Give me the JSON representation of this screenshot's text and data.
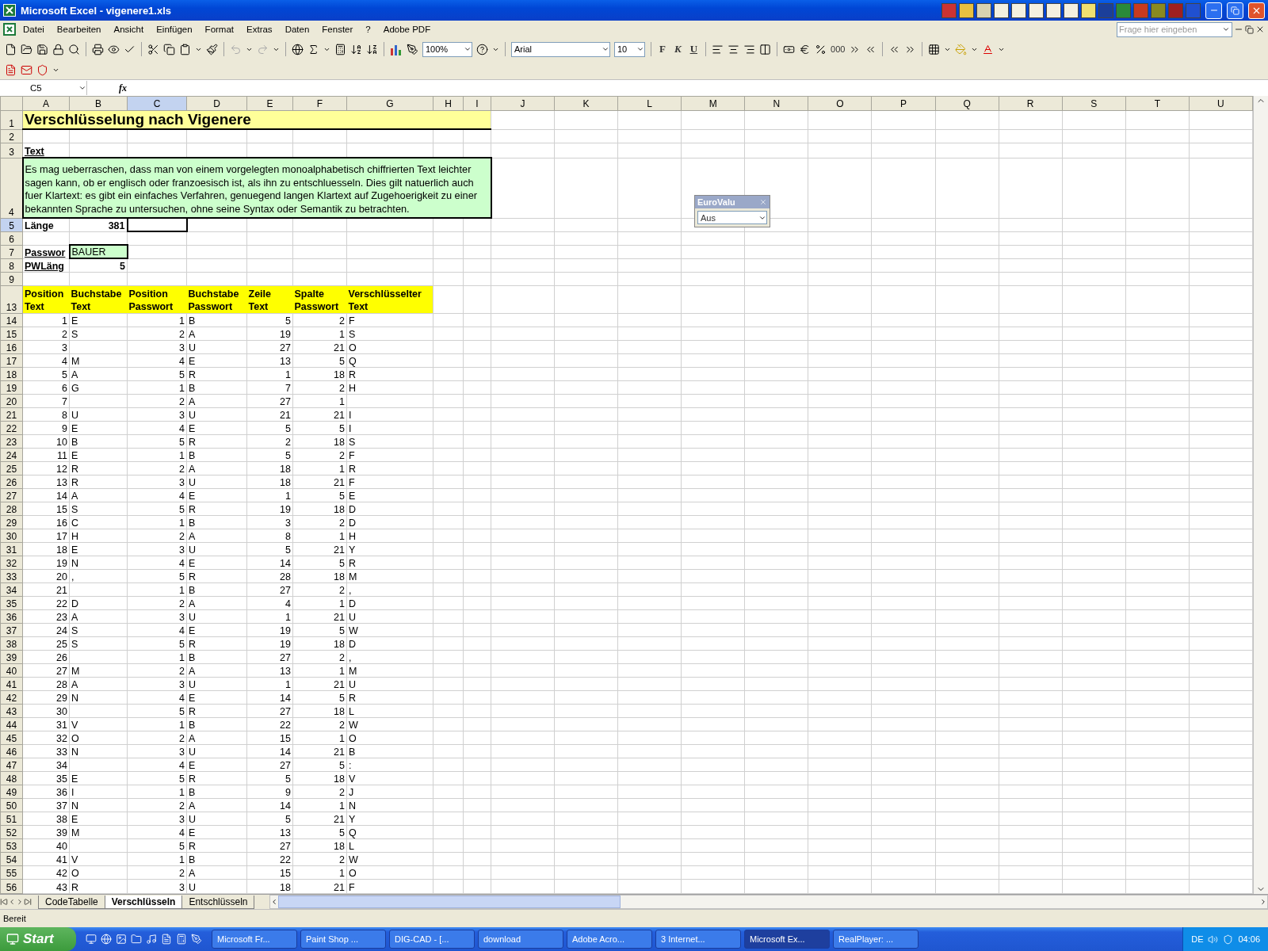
{
  "window": {
    "title": "Microsoft Excel - vigenere1.xls"
  },
  "menu": [
    "Datei",
    "Bearbeiten",
    "Ansicht",
    "Einfügen",
    "Format",
    "Extras",
    "Daten",
    "Fenster",
    "?",
    "Adobe PDF"
  ],
  "help_box": {
    "placeholder": "Frage hier eingeben"
  },
  "toolbar": {
    "zoom": "100%",
    "font": "Arial",
    "font_size": "10",
    "style_buttons": [
      "F",
      "K",
      "U"
    ],
    "thousands": "000"
  },
  "formula_bar": {
    "name_box": "C5",
    "function_symbol": "fx"
  },
  "columns": [
    {
      "label": "A",
      "selected": false
    },
    {
      "label": "B",
      "selected": false
    },
    {
      "label": "C",
      "selected": true
    },
    {
      "label": "D",
      "selected": false
    },
    {
      "label": "E",
      "selected": false
    },
    {
      "label": "F",
      "selected": false
    },
    {
      "label": "G",
      "selected": false
    },
    {
      "label": "H",
      "selected": false
    },
    {
      "label": "I",
      "selected": false
    },
    {
      "label": "J",
      "selected": false
    },
    {
      "label": "K",
      "selected": false
    },
    {
      "label": "L",
      "selected": false
    },
    {
      "label": "M",
      "selected": false
    },
    {
      "label": "N",
      "selected": false
    },
    {
      "label": "O",
      "selected": false
    },
    {
      "label": "P",
      "selected": false
    },
    {
      "label": "Q",
      "selected": false
    },
    {
      "label": "R",
      "selected": false
    },
    {
      "label": "S",
      "selected": false
    },
    {
      "label": "T",
      "selected": false
    },
    {
      "label": "U",
      "selected": false
    }
  ],
  "sheet": {
    "rows": [
      {
        "number": "1",
        "selected": false,
        "kind": "title",
        "text": "Verschlüsselung nach Vigenere"
      },
      {
        "number": "2",
        "selected": false,
        "kind": "empty"
      },
      {
        "number": "3",
        "selected": false,
        "kind": "label",
        "label": "Text"
      },
      {
        "number": "4",
        "selected": false,
        "kind": "paragraph",
        "text": "Es mag ueberraschen, dass man von einem vorgelegten monoalphabetisch chiffrierten Text leichter sagen kann, ob er englisch oder franzoesisch ist, als ihn zu entschluesseln. Dies gilt natuerlich auch fuer Klartext: es gibt ein einfaches Verfahren, genuegend langen Klartext auf Zugehoerigkeit zu einer bekannten Sprache zu untersuchen, ohne seine Syntax oder Semantik zu betrachten."
      },
      {
        "number": "5",
        "selected": true,
        "kind": "value",
        "label": "Länge",
        "value": "381"
      },
      {
        "number": "6",
        "selected": false,
        "kind": "empty"
      },
      {
        "number": "7",
        "selected": false,
        "kind": "input",
        "label": "Passwor",
        "value": "BAUER"
      },
      {
        "number": "8",
        "selected": false,
        "kind": "value",
        "label": "PWLäng",
        "value": "5"
      },
      {
        "number": "9",
        "selected": false,
        "kind": "empty"
      }
    ],
    "header": {
      "number": "13",
      "selected": false,
      "cells": [
        {
          "line1": "Position",
          "line2": "Text",
          "kind": "number"
        },
        {
          "line1": "Buchstabe",
          "line2": "Text",
          "kind": "letter"
        },
        {
          "line1": "Position",
          "line2": "Passwort",
          "kind": "number"
        },
        {
          "line1": "Buchstabe",
          "line2": "Passwort",
          "kind": "letter"
        },
        {
          "line1": "Zeile",
          "line2": "Text",
          "kind": "number"
        },
        {
          "line1": "Spalte",
          "line2": "Passwort",
          "kind": "number"
        },
        {
          "line1": "Verschlüsselter",
          "line2": "Text",
          "kind": "letter"
        }
      ]
    },
    "data": [
      {
        "number": "14",
        "selected": false,
        "cells": [
          "1",
          "E",
          "1",
          "B",
          "5",
          "2",
          "F"
        ]
      },
      {
        "number": "15",
        "selected": false,
        "cells": [
          "2",
          "S",
          "2",
          "A",
          "19",
          "1",
          "S"
        ]
      },
      {
        "number": "16",
        "selected": false,
        "cells": [
          "3",
          null,
          "3",
          "U",
          "27",
          "21",
          "O"
        ]
      },
      {
        "number": "17",
        "selected": false,
        "cells": [
          "4",
          "M",
          "4",
          "E",
          "13",
          "5",
          "Q"
        ]
      },
      {
        "number": "18",
        "selected": false,
        "cells": [
          "5",
          "A",
          "5",
          "R",
          "1",
          "18",
          "R"
        ]
      },
      {
        "number": "19",
        "selected": false,
        "cells": [
          "6",
          "G",
          "1",
          "B",
          "7",
          "2",
          "H"
        ]
      },
      {
        "number": "20",
        "selected": false,
        "cells": [
          "7",
          null,
          "2",
          "A",
          "27",
          "1",
          null
        ]
      },
      {
        "number": "21",
        "selected": false,
        "cells": [
          "8",
          "U",
          "3",
          "U",
          "21",
          "21",
          "I"
        ]
      },
      {
        "number": "22",
        "selected": false,
        "cells": [
          "9",
          "E",
          "4",
          "E",
          "5",
          "5",
          "I"
        ]
      },
      {
        "number": "23",
        "selected": false,
        "cells": [
          "10",
          "B",
          "5",
          "R",
          "2",
          "18",
          "S"
        ]
      },
      {
        "number": "24",
        "selected": false,
        "cells": [
          "11",
          "E",
          "1",
          "B",
          "5",
          "2",
          "F"
        ]
      },
      {
        "number": "25",
        "selected": false,
        "cells": [
          "12",
          "R",
          "2",
          "A",
          "18",
          "1",
          "R"
        ]
      },
      {
        "number": "26",
        "selected": false,
        "cells": [
          "13",
          "R",
          "3",
          "U",
          "18",
          "21",
          "F"
        ]
      },
      {
        "number": "27",
        "selected": false,
        "cells": [
          "14",
          "A",
          "4",
          "E",
          "1",
          "5",
          "E"
        ]
      },
      {
        "number": "28",
        "selected": false,
        "cells": [
          "15",
          "S",
          "5",
          "R",
          "19",
          "18",
          "D"
        ]
      },
      {
        "number": "29",
        "selected": false,
        "cells": [
          "16",
          "C",
          "1",
          "B",
          "3",
          "2",
          "D"
        ]
      },
      {
        "number": "30",
        "selected": false,
        "cells": [
          "17",
          "H",
          "2",
          "A",
          "8",
          "1",
          "H"
        ]
      },
      {
        "number": "31",
        "selected": false,
        "cells": [
          "18",
          "E",
          "3",
          "U",
          "5",
          "21",
          "Y"
        ]
      },
      {
        "number": "32",
        "selected": false,
        "cells": [
          "19",
          "N",
          "4",
          "E",
          "14",
          "5",
          "R"
        ]
      },
      {
        "number": "33",
        "selected": false,
        "cells": [
          "20",
          ",",
          "5",
          "R",
          "28",
          "18",
          "M"
        ]
      },
      {
        "number": "34",
        "selected": false,
        "cells": [
          "21",
          null,
          "1",
          "B",
          "27",
          "2",
          ","
        ]
      },
      {
        "number": "35",
        "selected": false,
        "cells": [
          "22",
          "D",
          "2",
          "A",
          "4",
          "1",
          "D"
        ]
      },
      {
        "number": "36",
        "selected": false,
        "cells": [
          "23",
          "A",
          "3",
          "U",
          "1",
          "21",
          "U"
        ]
      },
      {
        "number": "37",
        "selected": false,
        "cells": [
          "24",
          "S",
          "4",
          "E",
          "19",
          "5",
          "W"
        ]
      },
      {
        "number": "38",
        "selected": false,
        "cells": [
          "25",
          "S",
          "5",
          "R",
          "19",
          "18",
          "D"
        ]
      },
      {
        "number": "39",
        "selected": false,
        "cells": [
          "26",
          null,
          "1",
          "B",
          "27",
          "2",
          ","
        ]
      },
      {
        "number": "40",
        "selected": false,
        "cells": [
          "27",
          "M",
          "2",
          "A",
          "13",
          "1",
          "M"
        ]
      },
      {
        "number": "41",
        "selected": false,
        "cells": [
          "28",
          "A",
          "3",
          "U",
          "1",
          "21",
          "U"
        ]
      },
      {
        "number": "42",
        "selected": false,
        "cells": [
          "29",
          "N",
          "4",
          "E",
          "14",
          "5",
          "R"
        ]
      },
      {
        "number": "43",
        "selected": false,
        "cells": [
          "30",
          null,
          "5",
          "R",
          "27",
          "18",
          "L"
        ]
      },
      {
        "number": "44",
        "selected": false,
        "cells": [
          "31",
          "V",
          "1",
          "B",
          "22",
          "2",
          "W"
        ]
      },
      {
        "number": "45",
        "selected": false,
        "cells": [
          "32",
          "O",
          "2",
          "A",
          "15",
          "1",
          "O"
        ]
      },
      {
        "number": "46",
        "selected": false,
        "cells": [
          "33",
          "N",
          "3",
          "U",
          "14",
          "21",
          "B"
        ]
      },
      {
        "number": "47",
        "selected": false,
        "cells": [
          "34",
          null,
          "4",
          "E",
          "27",
          "5",
          ":"
        ]
      },
      {
        "number": "48",
        "selected": false,
        "cells": [
          "35",
          "E",
          "5",
          "R",
          "5",
          "18",
          "V"
        ]
      },
      {
        "number": "49",
        "selected": false,
        "cells": [
          "36",
          "I",
          "1",
          "B",
          "9",
          "2",
          "J"
        ]
      },
      {
        "number": "50",
        "selected": false,
        "cells": [
          "37",
          "N",
          "2",
          "A",
          "14",
          "1",
          "N"
        ]
      },
      {
        "number": "51",
        "selected": false,
        "cells": [
          "38",
          "E",
          "3",
          "U",
          "5",
          "21",
          "Y"
        ]
      },
      {
        "number": "52",
        "selected": false,
        "cells": [
          "39",
          "M",
          "4",
          "E",
          "13",
          "5",
          "Q"
        ]
      },
      {
        "number": "53",
        "selected": false,
        "cells": [
          "40",
          null,
          "5",
          "R",
          "27",
          "18",
          "L"
        ]
      },
      {
        "number": "54",
        "selected": false,
        "cells": [
          "41",
          "V",
          "1",
          "B",
          "22",
          "2",
          "W"
        ]
      },
      {
        "number": "55",
        "selected": false,
        "cells": [
          "42",
          "O",
          "2",
          "A",
          "15",
          "1",
          "O"
        ]
      },
      {
        "number": "56",
        "selected": false,
        "cells": [
          "43",
          "R",
          "3",
          "U",
          "18",
          "21",
          "F"
        ]
      }
    ]
  },
  "euro_toolbar": {
    "title": "EuroValu",
    "value": "Aus"
  },
  "sheet_tabs": [
    {
      "label": "CodeTabelle",
      "selected": false
    },
    {
      "label": "Verschlüsseln",
      "selected": true
    },
    {
      "label": "Entschlüsseln",
      "selected": false
    }
  ],
  "status": "Bereit",
  "taskbar": {
    "start": "Start",
    "tasks": [
      {
        "label": "Microsoft Fr...",
        "selected": false
      },
      {
        "label": "Paint Shop ...",
        "selected": false
      },
      {
        "label": "DIG-CAD - [...",
        "selected": false
      },
      {
        "label": "download",
        "selected": false
      },
      {
        "label": "Adobe Acro...",
        "selected": false
      },
      {
        "label": "3 Internet...",
        "selected": false
      },
      {
        "label": "Microsoft Ex...",
        "selected": true
      },
      {
        "label": "RealPlayer: ...",
        "selected": false
      }
    ],
    "language": "DE",
    "time": "04:06"
  }
}
